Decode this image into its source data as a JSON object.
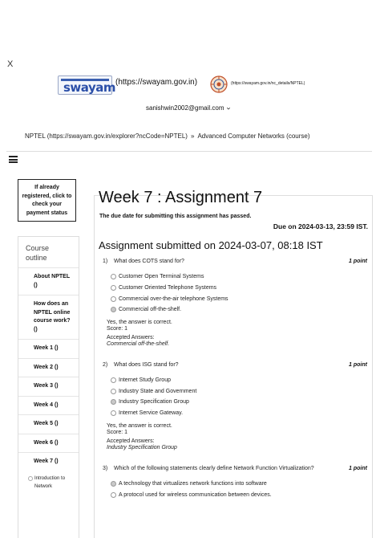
{
  "header": {
    "close_symbol": "X",
    "swayam_logo_text": "swayam",
    "swayam_logo_tagline": "",
    "swayam_link": "(https://swayam.gov.in)",
    "nptel_link": "(https://swayam.gov.in/nc_details/NPTEL)",
    "user_email": "sanishwin2002@gmail.com",
    "icons": {
      "user_menu": "chevron-down-icon",
      "menu": "hamburger-menu-icon"
    }
  },
  "breadcrumb": {
    "root": "NPTEL (https://swayam.gov.in/explorer?ncCode=NPTEL)",
    "separator": "»",
    "current": "Advanced Computer Networks (course)"
  },
  "payment_button": {
    "label": "If already registered, click to check your payment status"
  },
  "sidebar": {
    "title": "Course outline",
    "items": [
      {
        "label": "About NPTEL ()"
      },
      {
        "label": "How does an NPTEL online course work? ()"
      },
      {
        "label": "Week 1 ()"
      },
      {
        "label": "Week 2 ()"
      },
      {
        "label": "Week 3 ()"
      },
      {
        "label": "Week 4 ()"
      },
      {
        "label": "Week 5 ()"
      },
      {
        "label": "Week 6 ()"
      },
      {
        "label": "Week 7 ()"
      }
    ],
    "subitems": [
      {
        "label": "Introduction to Network"
      }
    ]
  },
  "assignment": {
    "title": "Week 7 : Assignment 7",
    "due_passed": "The due date for submitting this assignment has passed.",
    "due_on": "Due on 2024-03-13, 23:59 IST.",
    "submitted": "Assignment submitted on 2024-03-07, 08:18 IST",
    "questions": [
      {
        "number": "1)",
        "text": "What does COTS stand for?",
        "points": "1 point",
        "options": [
          "Customer Open Terminal Systems",
          "Customer Oriented Telephone Systems",
          "Commercial over-the-air telephone Systems",
          "Commercial off-the-shelf."
        ],
        "selected_index": 3,
        "feedback": "Yes, the answer is correct.",
        "score": "Score: 1",
        "accepted_label": "Accepted Answers:",
        "accepted": "Commercial off-the-shelf."
      },
      {
        "number": "2)",
        "text": "What does ISG stand for?",
        "points": "1 point",
        "options": [
          "Internet Study Group",
          "Industry State and Government",
          "Industry Specification Group",
          "Internet Service Gateway."
        ],
        "selected_index": 2,
        "feedback": "Yes, the answer is correct.",
        "score": "Score: 1",
        "accepted_label": "Accepted Answers:",
        "accepted": "Industry Specification Group"
      },
      {
        "number": "3)",
        "text": "Which of the following statements clearly define Network Function Virtualization?",
        "points": "1 point",
        "options": [
          "A technology that virtualizes network functions into software",
          "A protocol used for wireless communication between devices."
        ],
        "selected_index": 0
      }
    ]
  }
}
